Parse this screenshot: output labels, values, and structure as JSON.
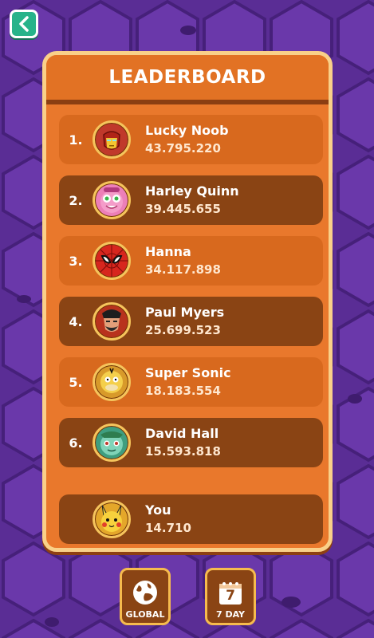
{
  "header": {
    "title": "LEADERBOARD"
  },
  "entries": [
    {
      "rank": "1.",
      "name": "Lucky Noob",
      "score": "43.795.220",
      "avatar": "iron-man-avatar"
    },
    {
      "rank": "2.",
      "name": "Harley Quinn",
      "score": "39.445.655",
      "avatar": "pink-monster-avatar"
    },
    {
      "rank": "3.",
      "name": "Hanna",
      "score": "34.117.898",
      "avatar": "spider-man-avatar"
    },
    {
      "rank": "4.",
      "name": "Paul Myers",
      "score": "25.699.523",
      "avatar": "bearded-villain-avatar"
    },
    {
      "rank": "5.",
      "name": "Super Sonic",
      "score": "18.183.554",
      "avatar": "psyduck-avatar"
    },
    {
      "rank": "6.",
      "name": "David Hall",
      "score": "15.593.818",
      "avatar": "bulbasaur-avatar"
    }
  ],
  "you": {
    "name": "You",
    "score": "14.710",
    "avatar": "pikachu-avatar"
  },
  "tabs": {
    "global": {
      "label": "GLOBAL",
      "icon": "globe-icon"
    },
    "seven_day": {
      "label": "7 DAY",
      "icon": "calendar-icon",
      "day": "7"
    }
  },
  "colors": {
    "background": "#5a2d95",
    "panel": "#e9782c",
    "row_light": "#d8691e",
    "row_dark": "#8a4414",
    "back_button": "#27b38a"
  }
}
